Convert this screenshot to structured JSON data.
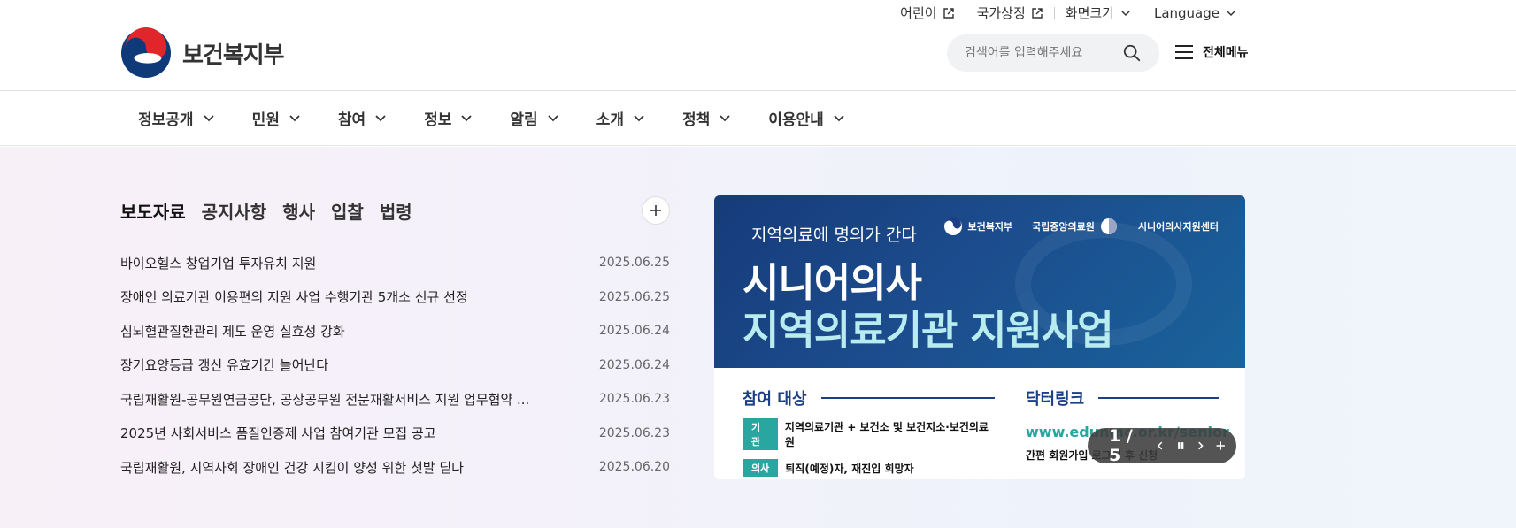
{
  "utility": {
    "kids": "어린이",
    "symbol": "국가상징",
    "screen_size": "화면크기",
    "language": "Language"
  },
  "header": {
    "logo_text": "보건복지부",
    "search_placeholder": "검색어를 입력해주세요",
    "all_menu": "전체메뉴"
  },
  "gnb": {
    "items": [
      "정보공개",
      "민원",
      "참여",
      "정보",
      "알림",
      "소개",
      "정책",
      "이용안내"
    ]
  },
  "board": {
    "tabs": [
      "보도자료",
      "공지사항",
      "행사",
      "입찰",
      "법령"
    ],
    "items": [
      {
        "title": "바이오헬스 창업기업 투자유치 지원",
        "date": "2025.06.25"
      },
      {
        "title": "장애인 의료기관 이용편의 지원 사업 수행기관 5개소 신규 선정",
        "date": "2025.06.25"
      },
      {
        "title": "심뇌혈관질환관리 제도 운영 실효성 강화",
        "date": "2025.06.24"
      },
      {
        "title": "장기요양등급 갱신 유효기간 늘어난다",
        "date": "2025.06.24"
      },
      {
        "title": "국립재활원-공무원연금공단, 공상공무원 전문재활서비스 지원 업무협약 ...",
        "date": "2025.06.23"
      },
      {
        "title": "2025년 사회서비스 품질인증제 사업 참여기관 모집 공고",
        "date": "2025.06.23"
      },
      {
        "title": "국립재활원, 지역사회 장애인 건강 지킴이 양성 위한 첫발 딛다",
        "date": "2025.06.20"
      }
    ]
  },
  "banner": {
    "subtitle": "지역의료에 명의가 간다",
    "logo1": "보건복지부",
    "logo2": "국립중앙의료원",
    "logo3": "시니어의사지원센터",
    "title1": "시니어의사",
    "title2": "지역의료기관 지원사업",
    "left_heading": "참여 대상",
    "row1_tag": "기관",
    "row1_text": "지역의료기관 + 보건소 및 보건지소·보건의료원",
    "row2_tag": "의사",
    "row2_text": "퇴직(예정)자, 재진입 희망자",
    "right_heading": "닥터링크",
    "url": "www.edunmc.or.kr/senior",
    "note": "간편 회원가입 로그인 후 신청"
  },
  "slider": {
    "counter": "1 / 5"
  },
  "colors": {
    "accent_pink": "#f3a7b8",
    "banner_navy": "#1c3f86",
    "banner_teal": "#2aa6a1"
  }
}
